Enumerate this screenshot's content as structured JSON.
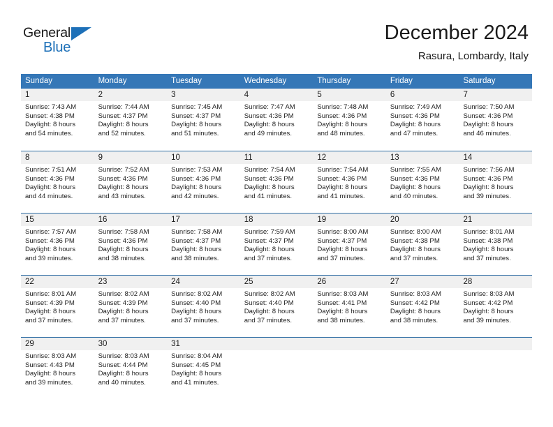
{
  "brand": {
    "name_part1": "General",
    "name_part2": "Blue",
    "triangle_icon": "blue-triangle-logo-mark",
    "accent_color": "#1d70b8"
  },
  "header": {
    "title": "December 2024",
    "subtitle": "Rasura, Lombardy, Italy"
  },
  "theme": {
    "header_blue": "#3577b7",
    "row_border_blue": "#2e6da4",
    "day_band_gray": "#f0f0f0"
  },
  "calendar": {
    "month": "December",
    "year": "2024",
    "location": "Rasura, Lombardy, Italy",
    "day_headers": [
      "Sunday",
      "Monday",
      "Tuesday",
      "Wednesday",
      "Thursday",
      "Friday",
      "Saturday"
    ],
    "weeks": [
      [
        {
          "day": "1",
          "sunrise": "Sunrise: 7:43 AM",
          "sunset": "Sunset: 4:38 PM",
          "daylight_line1": "Daylight: 8 hours",
          "daylight_line2": "and 54 minutes."
        },
        {
          "day": "2",
          "sunrise": "Sunrise: 7:44 AM",
          "sunset": "Sunset: 4:37 PM",
          "daylight_line1": "Daylight: 8 hours",
          "daylight_line2": "and 52 minutes."
        },
        {
          "day": "3",
          "sunrise": "Sunrise: 7:45 AM",
          "sunset": "Sunset: 4:37 PM",
          "daylight_line1": "Daylight: 8 hours",
          "daylight_line2": "and 51 minutes."
        },
        {
          "day": "4",
          "sunrise": "Sunrise: 7:47 AM",
          "sunset": "Sunset: 4:36 PM",
          "daylight_line1": "Daylight: 8 hours",
          "daylight_line2": "and 49 minutes."
        },
        {
          "day": "5",
          "sunrise": "Sunrise: 7:48 AM",
          "sunset": "Sunset: 4:36 PM",
          "daylight_line1": "Daylight: 8 hours",
          "daylight_line2": "and 48 minutes."
        },
        {
          "day": "6",
          "sunrise": "Sunrise: 7:49 AM",
          "sunset": "Sunset: 4:36 PM",
          "daylight_line1": "Daylight: 8 hours",
          "daylight_line2": "and 47 minutes."
        },
        {
          "day": "7",
          "sunrise": "Sunrise: 7:50 AM",
          "sunset": "Sunset: 4:36 PM",
          "daylight_line1": "Daylight: 8 hours",
          "daylight_line2": "and 46 minutes."
        }
      ],
      [
        {
          "day": "8",
          "sunrise": "Sunrise: 7:51 AM",
          "sunset": "Sunset: 4:36 PM",
          "daylight_line1": "Daylight: 8 hours",
          "daylight_line2": "and 44 minutes."
        },
        {
          "day": "9",
          "sunrise": "Sunrise: 7:52 AM",
          "sunset": "Sunset: 4:36 PM",
          "daylight_line1": "Daylight: 8 hours",
          "daylight_line2": "and 43 minutes."
        },
        {
          "day": "10",
          "sunrise": "Sunrise: 7:53 AM",
          "sunset": "Sunset: 4:36 PM",
          "daylight_line1": "Daylight: 8 hours",
          "daylight_line2": "and 42 minutes."
        },
        {
          "day": "11",
          "sunrise": "Sunrise: 7:54 AM",
          "sunset": "Sunset: 4:36 PM",
          "daylight_line1": "Daylight: 8 hours",
          "daylight_line2": "and 41 minutes."
        },
        {
          "day": "12",
          "sunrise": "Sunrise: 7:54 AM",
          "sunset": "Sunset: 4:36 PM",
          "daylight_line1": "Daylight: 8 hours",
          "daylight_line2": "and 41 minutes."
        },
        {
          "day": "13",
          "sunrise": "Sunrise: 7:55 AM",
          "sunset": "Sunset: 4:36 PM",
          "daylight_line1": "Daylight: 8 hours",
          "daylight_line2": "and 40 minutes."
        },
        {
          "day": "14",
          "sunrise": "Sunrise: 7:56 AM",
          "sunset": "Sunset: 4:36 PM",
          "daylight_line1": "Daylight: 8 hours",
          "daylight_line2": "and 39 minutes."
        }
      ],
      [
        {
          "day": "15",
          "sunrise": "Sunrise: 7:57 AM",
          "sunset": "Sunset: 4:36 PM",
          "daylight_line1": "Daylight: 8 hours",
          "daylight_line2": "and 39 minutes."
        },
        {
          "day": "16",
          "sunrise": "Sunrise: 7:58 AM",
          "sunset": "Sunset: 4:36 PM",
          "daylight_line1": "Daylight: 8 hours",
          "daylight_line2": "and 38 minutes."
        },
        {
          "day": "17",
          "sunrise": "Sunrise: 7:58 AM",
          "sunset": "Sunset: 4:37 PM",
          "daylight_line1": "Daylight: 8 hours",
          "daylight_line2": "and 38 minutes."
        },
        {
          "day": "18",
          "sunrise": "Sunrise: 7:59 AM",
          "sunset": "Sunset: 4:37 PM",
          "daylight_line1": "Daylight: 8 hours",
          "daylight_line2": "and 37 minutes."
        },
        {
          "day": "19",
          "sunrise": "Sunrise: 8:00 AM",
          "sunset": "Sunset: 4:37 PM",
          "daylight_line1": "Daylight: 8 hours",
          "daylight_line2": "and 37 minutes."
        },
        {
          "day": "20",
          "sunrise": "Sunrise: 8:00 AM",
          "sunset": "Sunset: 4:38 PM",
          "daylight_line1": "Daylight: 8 hours",
          "daylight_line2": "and 37 minutes."
        },
        {
          "day": "21",
          "sunrise": "Sunrise: 8:01 AM",
          "sunset": "Sunset: 4:38 PM",
          "daylight_line1": "Daylight: 8 hours",
          "daylight_line2": "and 37 minutes."
        }
      ],
      [
        {
          "day": "22",
          "sunrise": "Sunrise: 8:01 AM",
          "sunset": "Sunset: 4:39 PM",
          "daylight_line1": "Daylight: 8 hours",
          "daylight_line2": "and 37 minutes."
        },
        {
          "day": "23",
          "sunrise": "Sunrise: 8:02 AM",
          "sunset": "Sunset: 4:39 PM",
          "daylight_line1": "Daylight: 8 hours",
          "daylight_line2": "and 37 minutes."
        },
        {
          "day": "24",
          "sunrise": "Sunrise: 8:02 AM",
          "sunset": "Sunset: 4:40 PM",
          "daylight_line1": "Daylight: 8 hours",
          "daylight_line2": "and 37 minutes."
        },
        {
          "day": "25",
          "sunrise": "Sunrise: 8:02 AM",
          "sunset": "Sunset: 4:40 PM",
          "daylight_line1": "Daylight: 8 hours",
          "daylight_line2": "and 37 minutes."
        },
        {
          "day": "26",
          "sunrise": "Sunrise: 8:03 AM",
          "sunset": "Sunset: 4:41 PM",
          "daylight_line1": "Daylight: 8 hours",
          "daylight_line2": "and 38 minutes."
        },
        {
          "day": "27",
          "sunrise": "Sunrise: 8:03 AM",
          "sunset": "Sunset: 4:42 PM",
          "daylight_line1": "Daylight: 8 hours",
          "daylight_line2": "and 38 minutes."
        },
        {
          "day": "28",
          "sunrise": "Sunrise: 8:03 AM",
          "sunset": "Sunset: 4:42 PM",
          "daylight_line1": "Daylight: 8 hours",
          "daylight_line2": "and 39 minutes."
        }
      ],
      [
        {
          "day": "29",
          "sunrise": "Sunrise: 8:03 AM",
          "sunset": "Sunset: 4:43 PM",
          "daylight_line1": "Daylight: 8 hours",
          "daylight_line2": "and 39 minutes."
        },
        {
          "day": "30",
          "sunrise": "Sunrise: 8:03 AM",
          "sunset": "Sunset: 4:44 PM",
          "daylight_line1": "Daylight: 8 hours",
          "daylight_line2": "and 40 minutes."
        },
        {
          "day": "31",
          "sunrise": "Sunrise: 8:04 AM",
          "sunset": "Sunset: 4:45 PM",
          "daylight_line1": "Daylight: 8 hours",
          "daylight_line2": "and 41 minutes."
        },
        {
          "day": "",
          "sunrise": "",
          "sunset": "",
          "daylight_line1": "",
          "daylight_line2": ""
        },
        {
          "day": "",
          "sunrise": "",
          "sunset": "",
          "daylight_line1": "",
          "daylight_line2": ""
        },
        {
          "day": "",
          "sunrise": "",
          "sunset": "",
          "daylight_line1": "",
          "daylight_line2": ""
        },
        {
          "day": "",
          "sunrise": "",
          "sunset": "",
          "daylight_line1": "",
          "daylight_line2": ""
        }
      ]
    ]
  }
}
